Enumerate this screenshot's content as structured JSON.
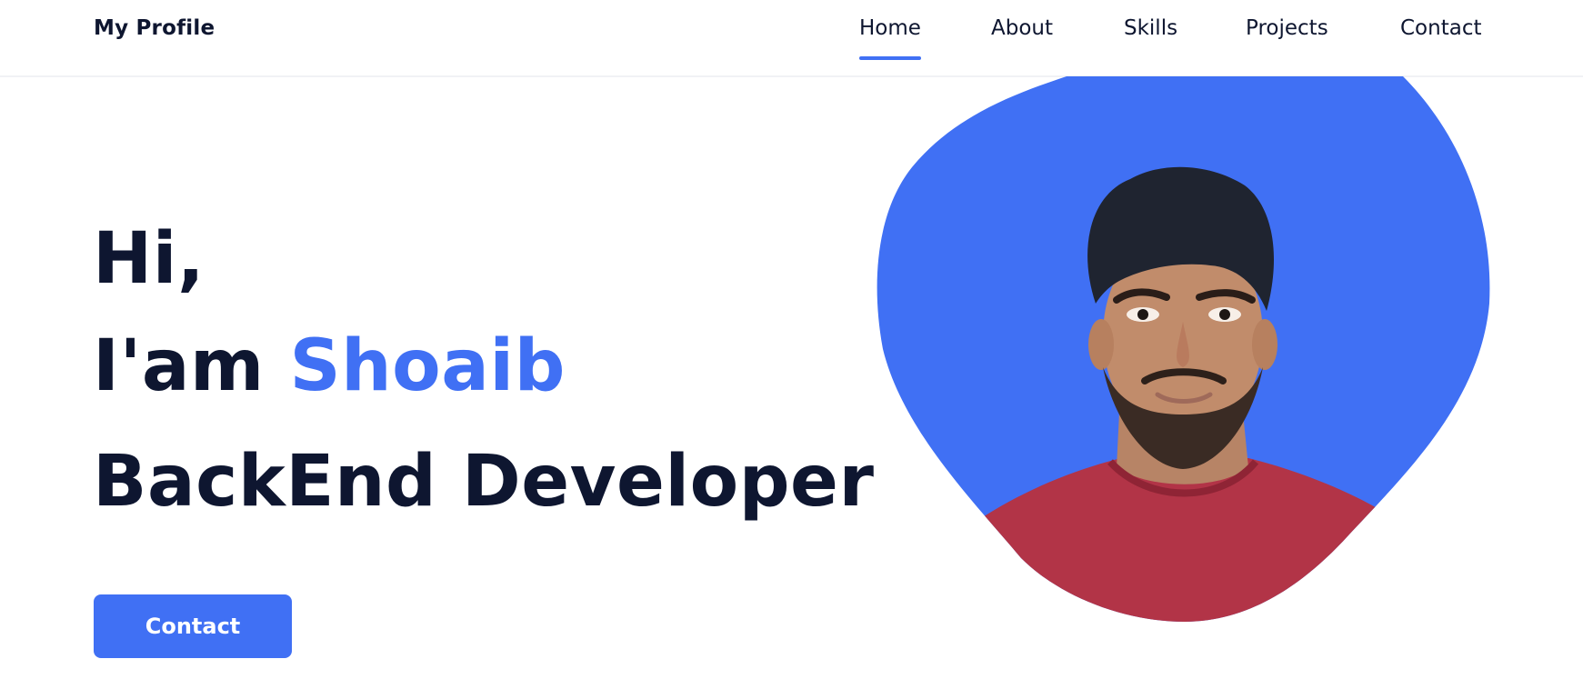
{
  "header": {
    "logo": "My Profile",
    "nav": [
      {
        "label": "Home",
        "active": true
      },
      {
        "label": "About",
        "active": false
      },
      {
        "label": "Skills",
        "active": false
      },
      {
        "label": "Projects",
        "active": false
      },
      {
        "label": "Contact",
        "active": false
      }
    ]
  },
  "hero": {
    "greeting": "Hi,",
    "intro": "I'am",
    "name": "Shoaib",
    "role": "BackEnd Developer",
    "cta_label": "Contact"
  },
  "colors": {
    "accent": "#4070f4",
    "text_dark": "#0e1630",
    "shirt": "#b23447",
    "hair": "#1f2430"
  },
  "icons": {
    "portrait": "profile-photo"
  }
}
